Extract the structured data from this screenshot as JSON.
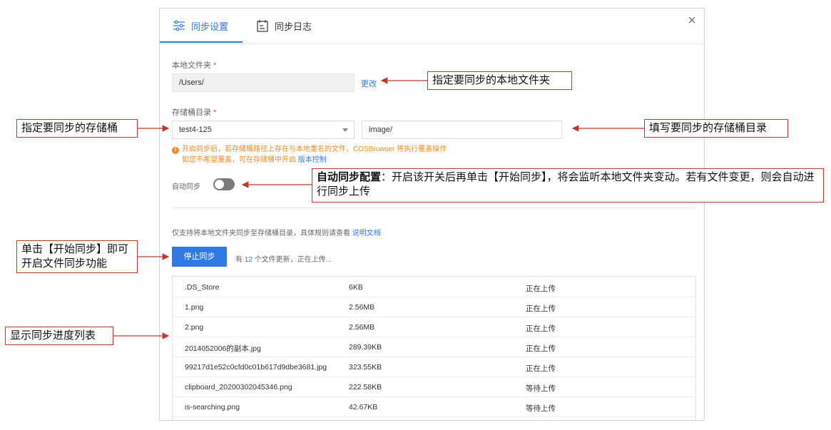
{
  "tabs": [
    {
      "label": "同步设置",
      "icon": "sliders-icon",
      "active": true
    },
    {
      "label": "同步日志",
      "icon": "log-icon",
      "active": false
    }
  ],
  "close_icon": "×",
  "local_folder": {
    "label": "本地文件夹",
    "required_mark": "*",
    "value": "/Users/",
    "change_link": "更改"
  },
  "bucket_dir": {
    "label": "存储桶目录",
    "required_mark": "*",
    "bucket_value": "test4-125",
    "path_value": "image/"
  },
  "warning": {
    "line1": "开启同步后，若存储桶路径上存在与本地重名的文件，COSBrowser 将执行覆盖操作",
    "line2_prefix": "如您不希望覆盖，可在存储桶中开启",
    "line2_link": "版本控制"
  },
  "auto_sync": {
    "label": "自动同步",
    "enabled": false
  },
  "hint": {
    "text": "仅支持将本地文件夹同步至存储桶目录，具体规则请查看",
    "link": "说明文档"
  },
  "stop_button": "停止同步",
  "progress": {
    "prefix": "有",
    "count": "12",
    "suffix": "个文件更新，正在上传..."
  },
  "files": [
    {
      "name": ".DS_Store",
      "size": "6KB",
      "status": "正在上传"
    },
    {
      "name": "1.png",
      "size": "2.56MB",
      "status": "正在上传"
    },
    {
      "name": "2.png",
      "size": "2.56MB",
      "status": "正在上传"
    },
    {
      "name": "2014052006的副本.jpg",
      "size": "289.39KB",
      "status": "正在上传"
    },
    {
      "name": "99217d1e52c0cfd0c01b617d9dbe3681.jpg",
      "size": "323.55KB",
      "status": "正在上传"
    },
    {
      "name": "clipboard_20200302045346.png",
      "size": "222.58KB",
      "status": "等待上传"
    },
    {
      "name": "is-searching.png",
      "size": "42.67KB",
      "status": "等待上传"
    }
  ],
  "annotations": {
    "local_folder": "指定要同步的本地文件夹",
    "bucket": "指定要同步的存储桶",
    "bucket_dir": "填写要同步的存储桶目录",
    "auto_sync_bold": "自动同步配置",
    "auto_sync_rest": "：开启该开关后再单击【开始同步】，将会监听本地文件夹变动。若有文件变更，则会自动进行同步上传",
    "start_sync": "单击【开始同步】即可开启文件同步功能",
    "progress_list": "显示同步进度列表"
  },
  "colors": {
    "accent": "#2f7ae5",
    "warning": "#f08a24",
    "callout_border": "#c0392b"
  }
}
